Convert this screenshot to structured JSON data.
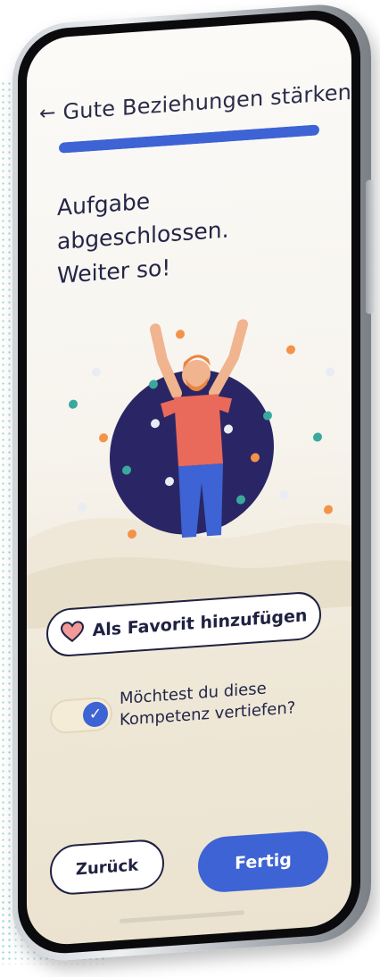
{
  "header": {
    "title": "Gute Beziehungen stärken",
    "back_icon": "arrow-left-icon"
  },
  "progress": {
    "value_percent": 100
  },
  "headline": {
    "line1": "Aufgabe abgeschlossen.",
    "line2": "Weiter so!"
  },
  "favorite": {
    "label": "Als Favorit hinzufügen",
    "icon": "heart-icon"
  },
  "toggle": {
    "checked": true,
    "line1": "Möchtest du diese",
    "line2": "Kompetenz vertiefen?"
  },
  "buttons": {
    "back_label": "Zurück",
    "done_label": "Fertig"
  },
  "colors": {
    "accent": "#3d63d4",
    "dark": "#232548",
    "circle": "#2a2666",
    "shirt": "#e9695a",
    "heart": "#f09a9a"
  }
}
